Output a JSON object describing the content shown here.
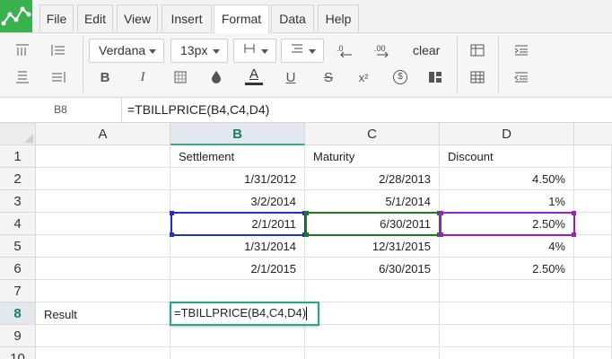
{
  "menu": {
    "items": [
      {
        "label": "File"
      },
      {
        "label": "Edit"
      },
      {
        "label": "View"
      },
      {
        "label": "Insert"
      },
      {
        "label": "Format"
      },
      {
        "label": "Data"
      },
      {
        "label": "Help"
      }
    ],
    "active": "Format"
  },
  "toolbar": {
    "font_family": "Verdana",
    "font_size": "13px",
    "clear_label": "clear",
    "bold": "B",
    "italic": "I",
    "text_color": "A",
    "underline": "U",
    "strike": "S",
    "superscript": "x²",
    "currency": "$"
  },
  "formula_bar": {
    "name_box": "B8",
    "formula": "=TBILLPRICE(B4,C4,D4)"
  },
  "sheet": {
    "columns": [
      "A",
      "B",
      "C",
      "D"
    ],
    "rows": [
      "1",
      "2",
      "3",
      "4",
      "5",
      "6",
      "7",
      "8",
      "9",
      "10"
    ],
    "selected_column": "B",
    "selected_row": "8",
    "cells": {
      "B1": "Settlement",
      "C1": "Maturity",
      "D1": "Discount",
      "B2": "1/31/2012",
      "C2": "2/28/2013",
      "D2": "4.50%",
      "B3": "3/2/2014",
      "C3": "5/1/2014",
      "D3": "1%",
      "B4": "2/1/2011",
      "C4": "6/30/2011",
      "D4": "2.50%",
      "B5": "1/31/2014",
      "C5": "12/31/2015",
      "D5": "4%",
      "B6": "2/1/2015",
      "C6": "6/30/2015",
      "D6": "2.50%",
      "A8": "Result"
    },
    "editor_text": "=TBILLPRICE(B4,C4,D4)"
  },
  "colors": {
    "accent": "#37b24d",
    "ref_b4": "#1f2fd0",
    "ref_c4": "#1b7a1b",
    "ref_d4": "#9b1fbf",
    "editor_border": "#2aa58a"
  }
}
